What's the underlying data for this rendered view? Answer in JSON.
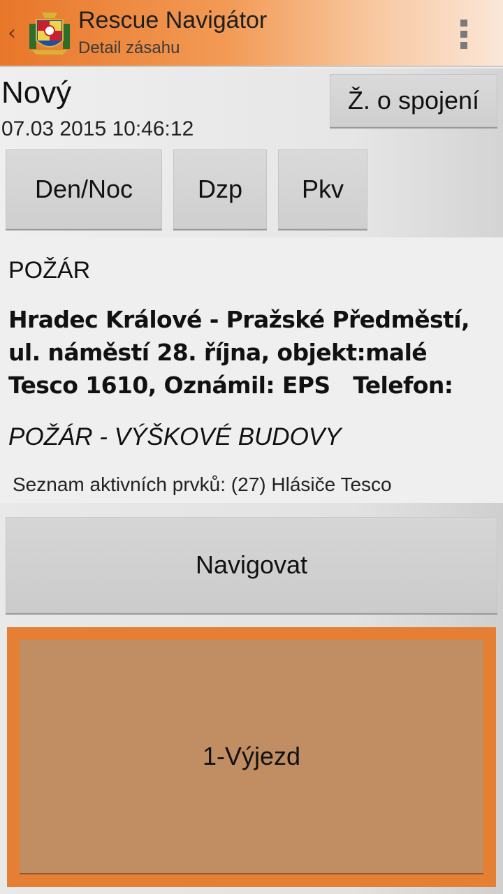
{
  "actionbar": {
    "title": "Rescue Navigátor",
    "subtitle": "Detail zásahu",
    "up_icon": "chevron-left-icon",
    "logo_icon": "coat-of-arms-logo",
    "overflow_icon": "overflow-menu-icon",
    "gradient_start": "#e8772a"
  },
  "header": {
    "status": "Nový",
    "datetime": "07.03 2015 10:46:12",
    "spojeni_label": "Ž. o spojení"
  },
  "mode_buttons": {
    "dennoc_label": "Den/Noc",
    "dzp_label": "Dzp",
    "pkv_label": "Pkv"
  },
  "detail": {
    "event_type": "POŽÁR",
    "address": "Hradec Králové - Pražské Předměstí,\nul. náměstí 28. října, objekt:malé\nTesco 1610, Oznámil: EPS   Telefon:",
    "subtype": "POŽÁR - VÝŠKOVÉ BUDOVY",
    "active_list": "Seznam aktivních prvků: (27) Hlásiče Tesco"
  },
  "actions": {
    "navigovat_label": "Navigovat",
    "vyjezd_label": "1-Výjezd",
    "vyjezd_color": "#c18d63",
    "vyjezd_frame_color": "#e57f34"
  }
}
